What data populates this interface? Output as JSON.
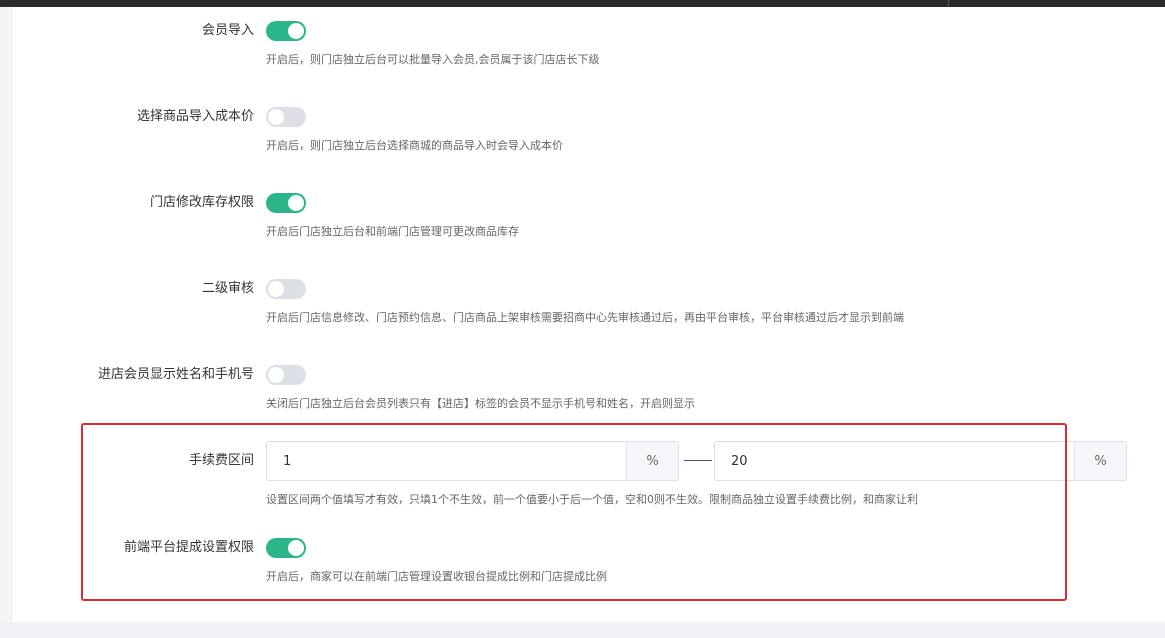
{
  "settings": [
    {
      "label": "会员导入",
      "on": true,
      "desc": "开启后，则门店独立后台可以批量导入会员,会员属于该门店店长下级"
    },
    {
      "label": "选择商品导入成本价",
      "on": false,
      "desc": "开启后，则门店独立后台选择商城的商品导入时会导入成本价"
    },
    {
      "label": "门店修改库存权限",
      "on": true,
      "desc": "开启后门店独立后台和前端门店管理可更改商品库存"
    },
    {
      "label": "二级审核",
      "on": false,
      "desc": "开启后门店信息修改、门店预约信息、门店商品上架审核需要招商中心先审核通过后，再由平台审核，平台审核通过后才显示到前端"
    },
    {
      "label": "进店会员显示姓名和手机号",
      "on": false,
      "desc": "关闭后门店独立后台会员列表只有【进店】标签的会员不显示手机号和姓名，开启则显示"
    }
  ],
  "fee_range": {
    "label": "手续费区间",
    "min_value": "1",
    "max_value": "20",
    "min_suffix": "%",
    "max_suffix": "%",
    "desc": "设置区间两个值填写才有效，只填1个不生效，前一个值要小于后一个值，空和0则不生效。限制商品独立设置手续费比例，和商家让利"
  },
  "frontend_commission": {
    "label": "前端平台提成设置权限",
    "on": true,
    "desc": "开启后，商家可以在前端门店管理设置收银台提成比例和门店提成比例"
  },
  "colors": {
    "switch_on": "#2bb58a",
    "switch_off": "#dcdfe6",
    "highlight_border": "#e22a2a"
  }
}
